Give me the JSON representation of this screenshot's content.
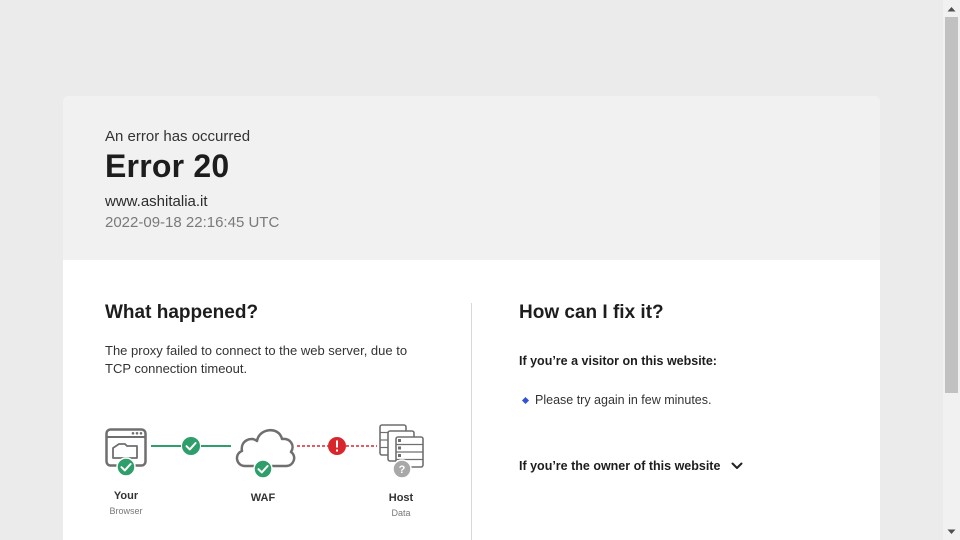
{
  "header": {
    "pre_title": "An error has occurred",
    "title": "Error 20",
    "domain": "www.ashitalia.it",
    "timestamp": "2022-09-18 22:16:45 UTC"
  },
  "what_happened": {
    "title": "What happened?",
    "description": "The proxy failed to connect to the web server, due to TCP connection timeout."
  },
  "diagram": {
    "nodes": [
      {
        "label": "Your",
        "sub": "Browser",
        "status": "ok"
      },
      {
        "label": "WAF",
        "sub": "",
        "status": "ok"
      },
      {
        "label": "Host",
        "sub": "Data",
        "status": "unknown"
      }
    ],
    "links": [
      {
        "status": "ok",
        "icon": "check-icon"
      },
      {
        "status": "error",
        "icon": "exclamation-icon"
      }
    ],
    "colors": {
      "ok": "#2e9e6b",
      "error": "#d9262c",
      "unknown": "#a8a8a8",
      "outline": "#6f6f6f"
    }
  },
  "fix": {
    "title": "How can I fix it?",
    "visitor_heading": "If you’re a visitor on this website:",
    "visitor_tip": "Please try again in few minutes.",
    "owner_heading": "If you’re the owner of this website"
  }
}
